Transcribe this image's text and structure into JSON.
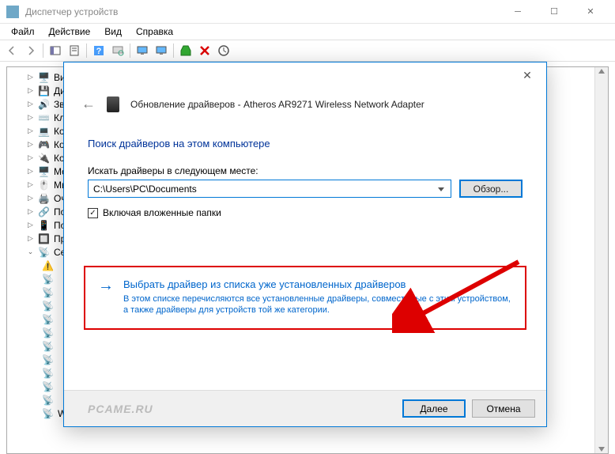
{
  "window": {
    "title": "Диспетчер устройств"
  },
  "menu": {
    "file": "Файл",
    "action": "Действие",
    "view": "Вид",
    "help": "Справка"
  },
  "tree": {
    "items": [
      {
        "label": "Ви",
        "icon": "video"
      },
      {
        "label": "Ди",
        "icon": "disk"
      },
      {
        "label": "Зву",
        "icon": "sound"
      },
      {
        "label": "Кл",
        "icon": "keyboard"
      },
      {
        "label": "Ко",
        "icon": "computer"
      },
      {
        "label": "Ко",
        "icon": "controller"
      },
      {
        "label": "Ко",
        "icon": "usb"
      },
      {
        "label": "Мо",
        "icon": "monitor"
      },
      {
        "label": "Мы",
        "icon": "mouse"
      },
      {
        "label": "Оч",
        "icon": "printer"
      },
      {
        "label": "По",
        "icon": "port"
      },
      {
        "label": "По",
        "icon": "portable"
      },
      {
        "label": "Пр",
        "icon": "processor"
      },
      {
        "label": "Сет",
        "icon": "network",
        "expanded": true
      }
    ],
    "last": "WAN Miniport (PPTP)"
  },
  "dialog": {
    "title": "Обновление драйверов - Atheros AR9271 Wireless Network Adapter",
    "heading": "Поиск драйверов на этом компьютере",
    "search_label": "Искать драйверы в следующем месте:",
    "path": "C:\\Users\\PC\\Documents",
    "browse": "Обзор...",
    "include_sub": "Включая вложенные папки",
    "option": {
      "title": "Выбрать драйвер из списка уже установленных драйверов",
      "desc": "В этом списке перечисляются все установленные драйверы, совместимые с этим устройством, а также драйверы для устройств той же категории."
    },
    "next": "Далее",
    "cancel": "Отмена"
  },
  "watermark": "PCAME.RU"
}
